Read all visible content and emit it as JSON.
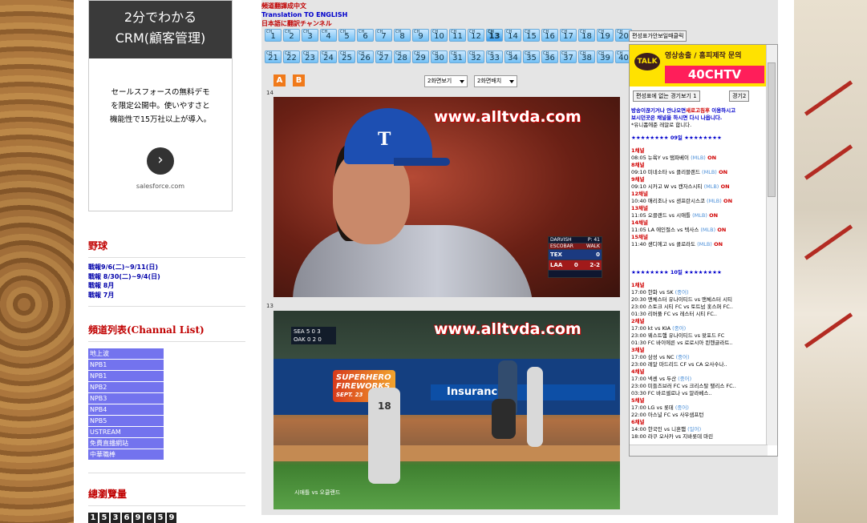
{
  "ad": {
    "title_line1": "2分でわかる",
    "title_line2": "CRM(顧客管理)",
    "body_line1": "セールスフォースの無料デモ",
    "body_line2": "を限定公開中。使いやすさと",
    "body_line3": "機能性で15万社以上が導入。",
    "arrow": "›",
    "source": "salesforce.com"
  },
  "sidebar": {
    "baseball_title": "野球",
    "schedule": [
      "戰報9/6(二)~9/11(日)",
      "戰報 8/30(二)~9/4(日)",
      "戰報 8月",
      "戰報 7月"
    ],
    "channels_title": "頻道列表(Channal List)",
    "channels": [
      "地上波",
      "NPB1",
      "NPB1",
      "NPB2",
      "NPB3",
      "NPB4",
      "NPB5",
      "USTREAM",
      "免費直播網站",
      "中華職棒"
    ],
    "views_title": "總瀏覽量",
    "counter": [
      "1",
      "5",
      "3",
      "6",
      "9",
      "6",
      "5",
      "9"
    ]
  },
  "main": {
    "lang_zh": "頻道翻譯成中文",
    "lang_en": "Translation TO ENGLISH",
    "lang_jp": "日本語に翻訳チャンネル",
    "ch_prefix": "CH",
    "row1": [
      "1",
      "2",
      "3",
      "4",
      "5",
      "6",
      "7",
      "8",
      "9",
      "10",
      "11",
      "12",
      "13",
      "14",
      "15",
      "16",
      "17",
      "18",
      "19",
      "20"
    ],
    "row2": [
      "21",
      "22",
      "23",
      "24",
      "25",
      "26",
      "27",
      "28",
      "29",
      "30",
      "31",
      "32",
      "33",
      "34",
      "35",
      "36",
      "37",
      "38",
      "39",
      "40"
    ],
    "selected_channel": "13",
    "top_button": "편성표가안보일때클릭",
    "a_btn": "A",
    "b_btn": "B",
    "select1": "2화면보기",
    "select2": "2화면배치",
    "video1_label": "14",
    "video2_label": "13",
    "watermark": "www.alltvda.com"
  },
  "video1": {
    "cap_letter": "T",
    "sb_row1_left": "DARVISH",
    "sb_row1_right": "P: 41",
    "sb_row2_left": "ESCOBAR",
    "sb_row2_right": "WALK",
    "sb_team1": "TEX",
    "sb_score1": "0",
    "sb_team2": "LAA",
    "sb_score2": "0",
    "sb_count": "2-2"
  },
  "video2": {
    "sb_line1": "SEA 5 0 3",
    "sb_line2": "OAK 0 2 0",
    "ad_left_1": "SUPERHERO",
    "ad_left_2": "FIREWORKS",
    "ad_left_3": "SEPT. 23",
    "ad_right": "Insurance",
    "caption": "시애틀 vs 오클랜드",
    "jersey": "18"
  },
  "right_panel": {
    "talk": "TALK",
    "kakao_line": "영상송출 / 홈피제작 문의",
    "kakao_id": "40CHTV",
    "btn1": "편성표에 없는 경기보기 1",
    "btn2": "경기2",
    "notice_1": "방송이끊기거나 안나오면",
    "notice_1b": "새로고침후",
    "notice_1c": " 이용하시고",
    "notice_2": "보시던곳은 채널을 하시면 다시 나옵니다.",
    "notice_3": "*유니폼에준 레알로 합니다.",
    "date1": "★★★★★★★★ 09일 ★★★★★★★★",
    "date2": "★★★★★★★★ 10일 ★★★★★★★★",
    "day9": [
      {
        "ch": "1채널"
      },
      {
        "t": "08:05 뉴욕Y vs 탬파베이",
        "tag": "(MLB)",
        "on": "ON"
      },
      {
        "ch": "8채널"
      },
      {
        "t": "09:10 미네소타 vs 클리블랜드",
        "tag": "(MLB)",
        "on": "ON"
      },
      {
        "ch": "9채널"
      },
      {
        "t": "09:10 시카고 W vs 캔자스시티",
        "tag": "(MLB)",
        "on": "ON"
      },
      {
        "ch": "12채널"
      },
      {
        "t": "10:40 애리조나 vs 샌프란시스코",
        "tag": "(MLB)",
        "on": "ON"
      },
      {
        "ch": "13채널"
      },
      {
        "t": "11:05 오클랜드 vs 시애틀",
        "tag": "(MLB)",
        "on": "ON"
      },
      {
        "ch": "14채널"
      },
      {
        "t": "11:05 LA 에인절스 vs 텍사스",
        "tag": "(MLB)",
        "on": "ON"
      },
      {
        "ch": "15채널"
      },
      {
        "t": "11:40 샌디에고 vs 콜로라도",
        "tag": "(MLB)",
        "on": "ON"
      }
    ],
    "day10": [
      {
        "ch": "1채널"
      },
      {
        "t": "17:00 한화 vs SK",
        "tag": "(중어)"
      },
      {
        "t": "20:30 맨체스터 유나이티드 vs 맨체스터 시티"
      },
      {
        "t": "23:00 스토크 시티 FC vs 토트넘 홋스퍼 FC.."
      },
      {
        "t": "01:30 리버풀 FC vs 레스터 시티 FC.."
      },
      {
        "ch": "2채널"
      },
      {
        "t": "17:00 kt vs KIA",
        "tag": "(중어)"
      },
      {
        "t": "23:00 웨스트햄 유나이티드 vs 왓포드 FC"
      },
      {
        "t": "01:30 FC 바이에른 vs 로로시아 묀헨글라트.."
      },
      {
        "ch": "3채널"
      },
      {
        "t": "17:00 삼성 vs NC",
        "tag": "(중어)"
      },
      {
        "t": "23:00 레알 마드리드 CF vs CA 오사수나.."
      },
      {
        "ch": "4채널"
      },
      {
        "t": "17:00 넥센 vs 두산",
        "tag": "(중어)"
      },
      {
        "t": "23:00 미들즈브러 FC vs 크리스탈 팰리스 FC.."
      },
      {
        "t": "03:30 FC 바르셀로나 vs 알라베스.."
      },
      {
        "ch": "5채널"
      },
      {
        "t": "17:00 LG vs 롯데",
        "tag": "(중어)"
      },
      {
        "t": "22:00 아스널 FC vs 사우샘프턴"
      },
      {
        "ch": "6채널"
      },
      {
        "t": "14:00 한국인 vs 니혼햄",
        "tag": "(일어)"
      },
      {
        "t": "18:00 라쿠 오사카 vs 지바롯데 마린"
      }
    ]
  }
}
